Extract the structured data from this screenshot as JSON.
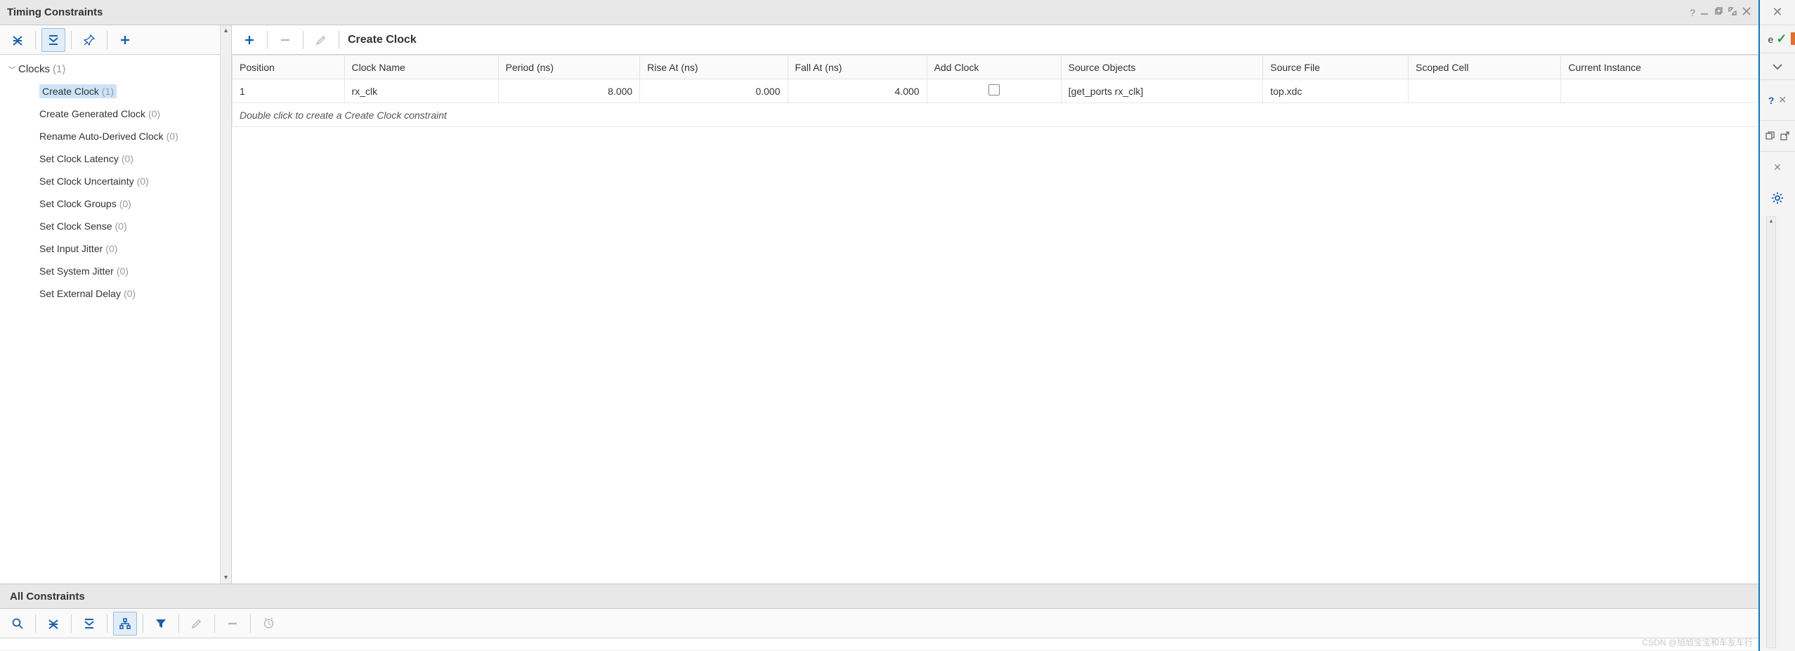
{
  "panel": {
    "title": "Timing Constraints"
  },
  "tree": {
    "group": {
      "label": "Clocks",
      "count": "(1)"
    },
    "items": [
      {
        "label": "Create Clock",
        "count": "(1)",
        "selected": true
      },
      {
        "label": "Create Generated Clock",
        "count": "(0)"
      },
      {
        "label": "Rename Auto-Derived Clock",
        "count": "(0)"
      },
      {
        "label": "Set Clock Latency",
        "count": "(0)"
      },
      {
        "label": "Set Clock Uncertainty",
        "count": "(0)"
      },
      {
        "label": "Set Clock Groups",
        "count": "(0)"
      },
      {
        "label": "Set Clock Sense",
        "count": "(0)"
      },
      {
        "label": "Set Input Jitter",
        "count": "(0)"
      },
      {
        "label": "Set System Jitter",
        "count": "(0)"
      },
      {
        "label": "Set External Delay",
        "count": "(0)"
      }
    ]
  },
  "detail": {
    "title": "Create Clock",
    "columns": [
      "Position",
      "Clock Name",
      "Period (ns)",
      "Rise At (ns)",
      "Fall At (ns)",
      "Add Clock",
      "Source Objects",
      "Source File",
      "Scoped Cell",
      "Current Instance"
    ],
    "row": {
      "position": "1",
      "clock_name": "rx_clk",
      "period": "8.000",
      "rise": "0.000",
      "fall": "4.000",
      "source_objects": "[get_ports rx_clk]",
      "source_file": "top.xdc",
      "scoped_cell": "",
      "current_instance": ""
    },
    "hint": "Double click to create a Create Clock constraint"
  },
  "bottom": {
    "title": "All Constraints"
  },
  "rightbar": {
    "letter": "e"
  },
  "watermark": "CSDN @旭旭宝宝和车友车行"
}
